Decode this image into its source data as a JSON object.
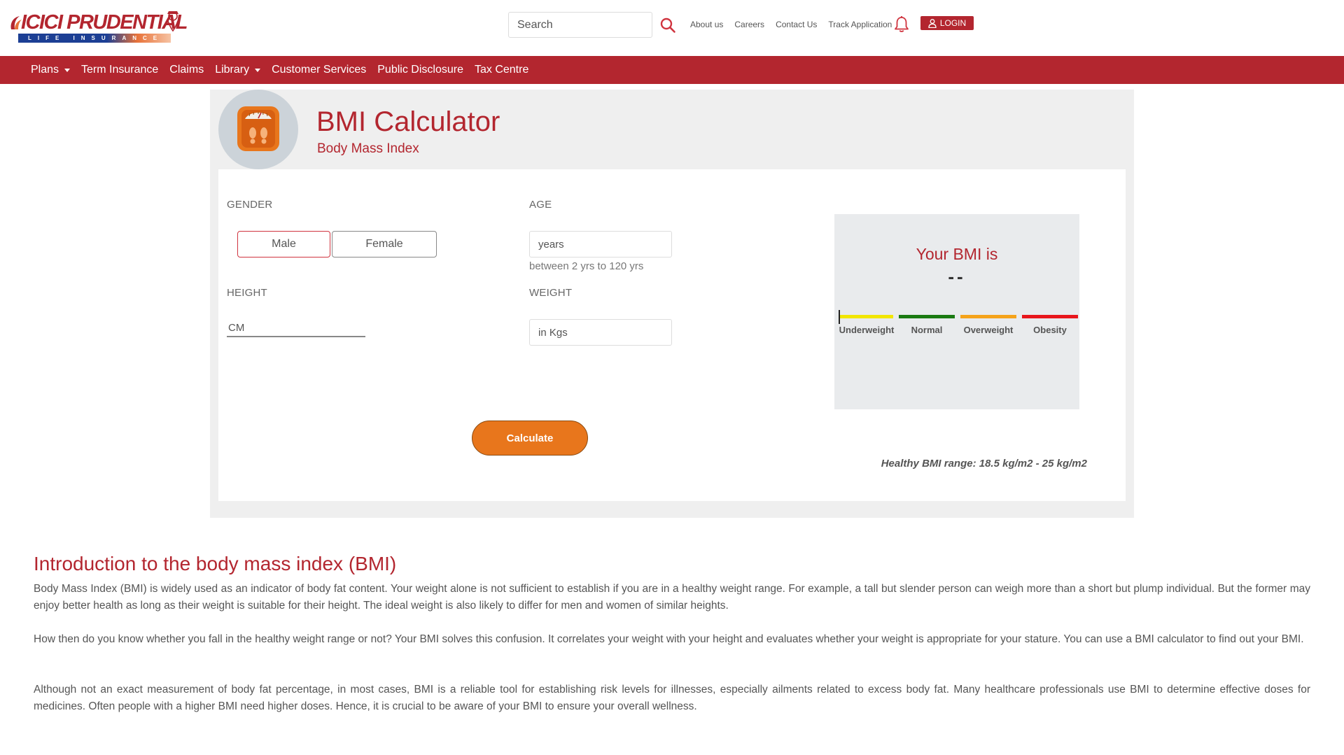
{
  "brand": {
    "logo_text": "ICICI PRUDENTIAL",
    "logo_tagline": "LIFE INSURANCE",
    "color_primary": "#b3262f",
    "color_accent": "#e8761c"
  },
  "header": {
    "search_placeholder": "Search",
    "search_icon": "search-icon",
    "links": [
      "About us",
      "Careers",
      "Contact Us",
      "Track Application"
    ],
    "bell_icon": "bell-icon",
    "login_label": "LOGIN",
    "login_icon": "user-icon"
  },
  "nav": {
    "items": [
      {
        "label": "Plans",
        "dropdown": true
      },
      {
        "label": "Term Insurance",
        "dropdown": false
      },
      {
        "label": "Claims",
        "dropdown": false
      },
      {
        "label": "Library",
        "dropdown": true
      },
      {
        "label": "Customer Services",
        "dropdown": false
      },
      {
        "label": "Public Disclosure",
        "dropdown": false
      },
      {
        "label": "Tax Centre",
        "dropdown": false
      }
    ]
  },
  "calculator": {
    "icon": "weighing-scale-icon",
    "title": "BMI Calculator",
    "subtitle": "Body Mass Index",
    "gender_label": "GENDER",
    "gender_options": [
      "Male",
      "Female"
    ],
    "gender_selected": "Male",
    "age_label": "AGE",
    "age_placeholder": "years",
    "age_hint": "between 2 yrs to 120 yrs",
    "height_label": "HEIGHT",
    "height_placeholder": "CM",
    "weight_label": "WEIGHT",
    "weight_placeholder": "in Kgs",
    "calculate_label": "Calculate",
    "result_title": "Your BMI is",
    "result_value": "--",
    "scale": [
      {
        "label": "Underweight",
        "color": "#f2e600"
      },
      {
        "label": "Normal",
        "color": "#1a7a12"
      },
      {
        "label": "Overweight",
        "color": "#f5a31a"
      },
      {
        "label": "Obesity",
        "color": "#e8161c"
      }
    ],
    "healthy_range": "Healthy BMI range: 18.5 kg/m2 - 25 kg/m2"
  },
  "article": {
    "title": "Introduction to the body mass index (BMI)",
    "paragraphs": [
      "Body Mass Index (BMI) is widely used as an indicator of body fat content. Your weight alone is not sufficient to establish if you are in a healthy weight range. For example, a tall but slender person can weigh more than a short but plump individual. But the former may enjoy better health as long as their weight is suitable for their height. The ideal weight is also likely to differ for men and women of similar heights.",
      "How then do you know whether you fall in the healthy weight range or not? Your BMI solves this confusion. It correlates your weight with your height and evaluates whether your weight is appropriate for your stature. You can use a BMI calculator to find out your BMI.",
      "Although not an exact measurement of body fat percentage, in most cases, BMI is a reliable tool for establishing risk levels for illnesses, especially ailments related to excess body fat. Many healthcare professionals use BMI to determine effective doses for medicines. Often people with a higher BMI need higher doses. Hence, it is crucial to be aware of your BMI to ensure your overall wellness."
    ]
  }
}
